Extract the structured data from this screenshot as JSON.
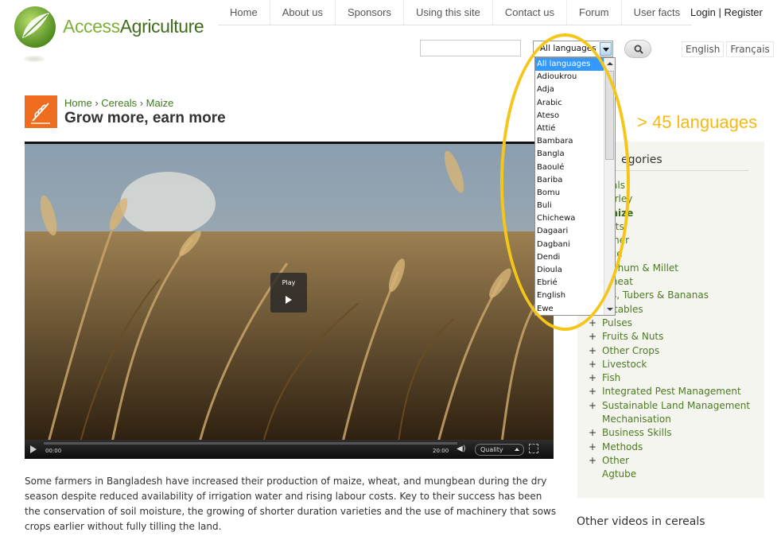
{
  "brand": {
    "name_part1": "Access",
    "name_part2": "Agriculture",
    "logo_icon": "leaf-globe-icon"
  },
  "nav": {
    "items": [
      "Home",
      "About us",
      "Sponsors",
      "Using this site",
      "Contact us",
      "Forum",
      "User facts"
    ],
    "login": "Login",
    "separator": "|",
    "register": "Register"
  },
  "search": {
    "value": "",
    "button_icon": "search-icon"
  },
  "language_select": {
    "selected": "All languages",
    "options": [
      "All languages",
      "Adioukrou",
      "Adja",
      "Arabic",
      "Ateso",
      "Attié",
      "Bambara",
      "Bangla",
      "Baoulé",
      "Bariba",
      "Bomu",
      "Buli",
      "Chichewa",
      "Dagaari",
      "Dagbani",
      "Dendi",
      "Dioula",
      "Ebrié",
      "English",
      "Ewe"
    ]
  },
  "site_languages": [
    "English",
    "Français"
  ],
  "annotation": "> 45 languages",
  "breadcrumb": {
    "home": "Home",
    "sep": "›",
    "category": "Cereals",
    "subcategory": "Maize"
  },
  "page_title": "Grow more, earn more",
  "category_icon": "wheat-icon",
  "video": {
    "play_label": "Play",
    "time_current": "00:00",
    "time_total": "20:00",
    "quality_label": "Quality",
    "volume_icon": "volume-icon",
    "fullscreen_icon": "fullscreen-icon"
  },
  "description": "Some farmers in Bangladesh have increased their production of maize, wheat, and mungbean during the dry season despite reduced availability of irrigation water and rising labour costs. Key to their success has been the conservation of soil moisture, the growing of shorter duration varieties and the use of machinery that sows crops earlier without fully tilling the land.",
  "sidebar": {
    "heading": "egories",
    "categories": [
      {
        "plus": "",
        "label": "reals",
        "bold": false
      },
      {
        "plus": "",
        "label": "Barley",
        "bold": false
      },
      {
        "plus": "",
        "label": "Maize",
        "bold": true
      },
      {
        "plus": "",
        "label": "Oats",
        "bold": false
      },
      {
        "plus": "",
        "label": "Other",
        "bold": false
      },
      {
        "plus": "",
        "label": "Rice",
        "bold": false
      },
      {
        "plus": "",
        "label": "orghum & Millet",
        "bold": false
      },
      {
        "plus": "",
        "label": "Wheat",
        "bold": false
      },
      {
        "plus": "",
        "label": "ots, Tubers & Bananas",
        "bold": false
      },
      {
        "plus": "",
        "label": "getables",
        "bold": false
      },
      {
        "plus": "+",
        "label": "Pulses",
        "bold": false
      },
      {
        "plus": "+",
        "label": "Fruits & Nuts",
        "bold": false
      },
      {
        "plus": "+",
        "label": "Other Crops",
        "bold": false
      },
      {
        "plus": "+",
        "label": "Livestock",
        "bold": false
      },
      {
        "plus": "+",
        "label": "Fish",
        "bold": false
      },
      {
        "plus": "+",
        "label": "Integrated Pest Management",
        "bold": false
      },
      {
        "plus": "+",
        "label": "Sustainable Land Management",
        "bold": false
      },
      {
        "plus": "",
        "label": "Mechanisation",
        "bold": false
      },
      {
        "plus": "+",
        "label": "Business Skills",
        "bold": false
      },
      {
        "plus": "+",
        "label": "Methods",
        "bold": false
      },
      {
        "plus": "+",
        "label": "Other",
        "bold": false
      },
      {
        "plus": "",
        "label": "Agtube",
        "bold": false
      }
    ]
  },
  "other_videos_heading": "Other videos in cereals",
  "colors": {
    "brand_light": "#7fae3a",
    "brand_dark": "#3f6d1a",
    "link_green": "#4d7a23",
    "highlight_yellow": "#f5c518",
    "select_blue": "#3399ff",
    "category_orange": "#ee6d1f"
  }
}
